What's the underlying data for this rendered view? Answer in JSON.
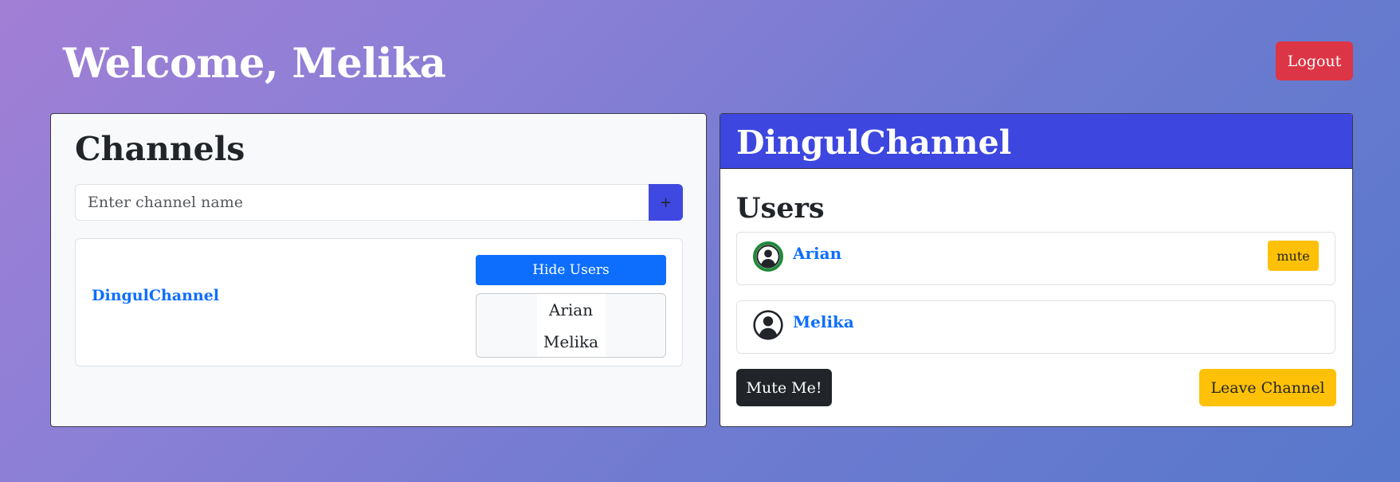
{
  "header": {
    "welcome": "Welcome, Melika",
    "logout_label": "Logout"
  },
  "channels": {
    "title": "Channels",
    "input_placeholder": "Enter channel name",
    "input_value": "",
    "add_label": "+",
    "list": [
      {
        "name": "DingulChannel",
        "toggle_label": "Hide Users",
        "users": [
          "Arian",
          "Melika"
        ]
      }
    ]
  },
  "active_channel": {
    "name": "DingulChannel",
    "users_title": "Users",
    "users": [
      {
        "name": "Arian",
        "status": "online",
        "action_label": "mute"
      },
      {
        "name": "Melika",
        "status": "offline"
      }
    ],
    "mute_me_label": "Mute Me!",
    "leave_label": "Leave Channel"
  },
  "colors": {
    "primary": "#0d6efd",
    "danger": "#dc3545",
    "warning": "#ffc107",
    "dark": "#212529",
    "header_blue": "#3d47e0",
    "online_ring": "#1f8a3a"
  },
  "icons": {
    "avatar": "person-circle-icon"
  }
}
